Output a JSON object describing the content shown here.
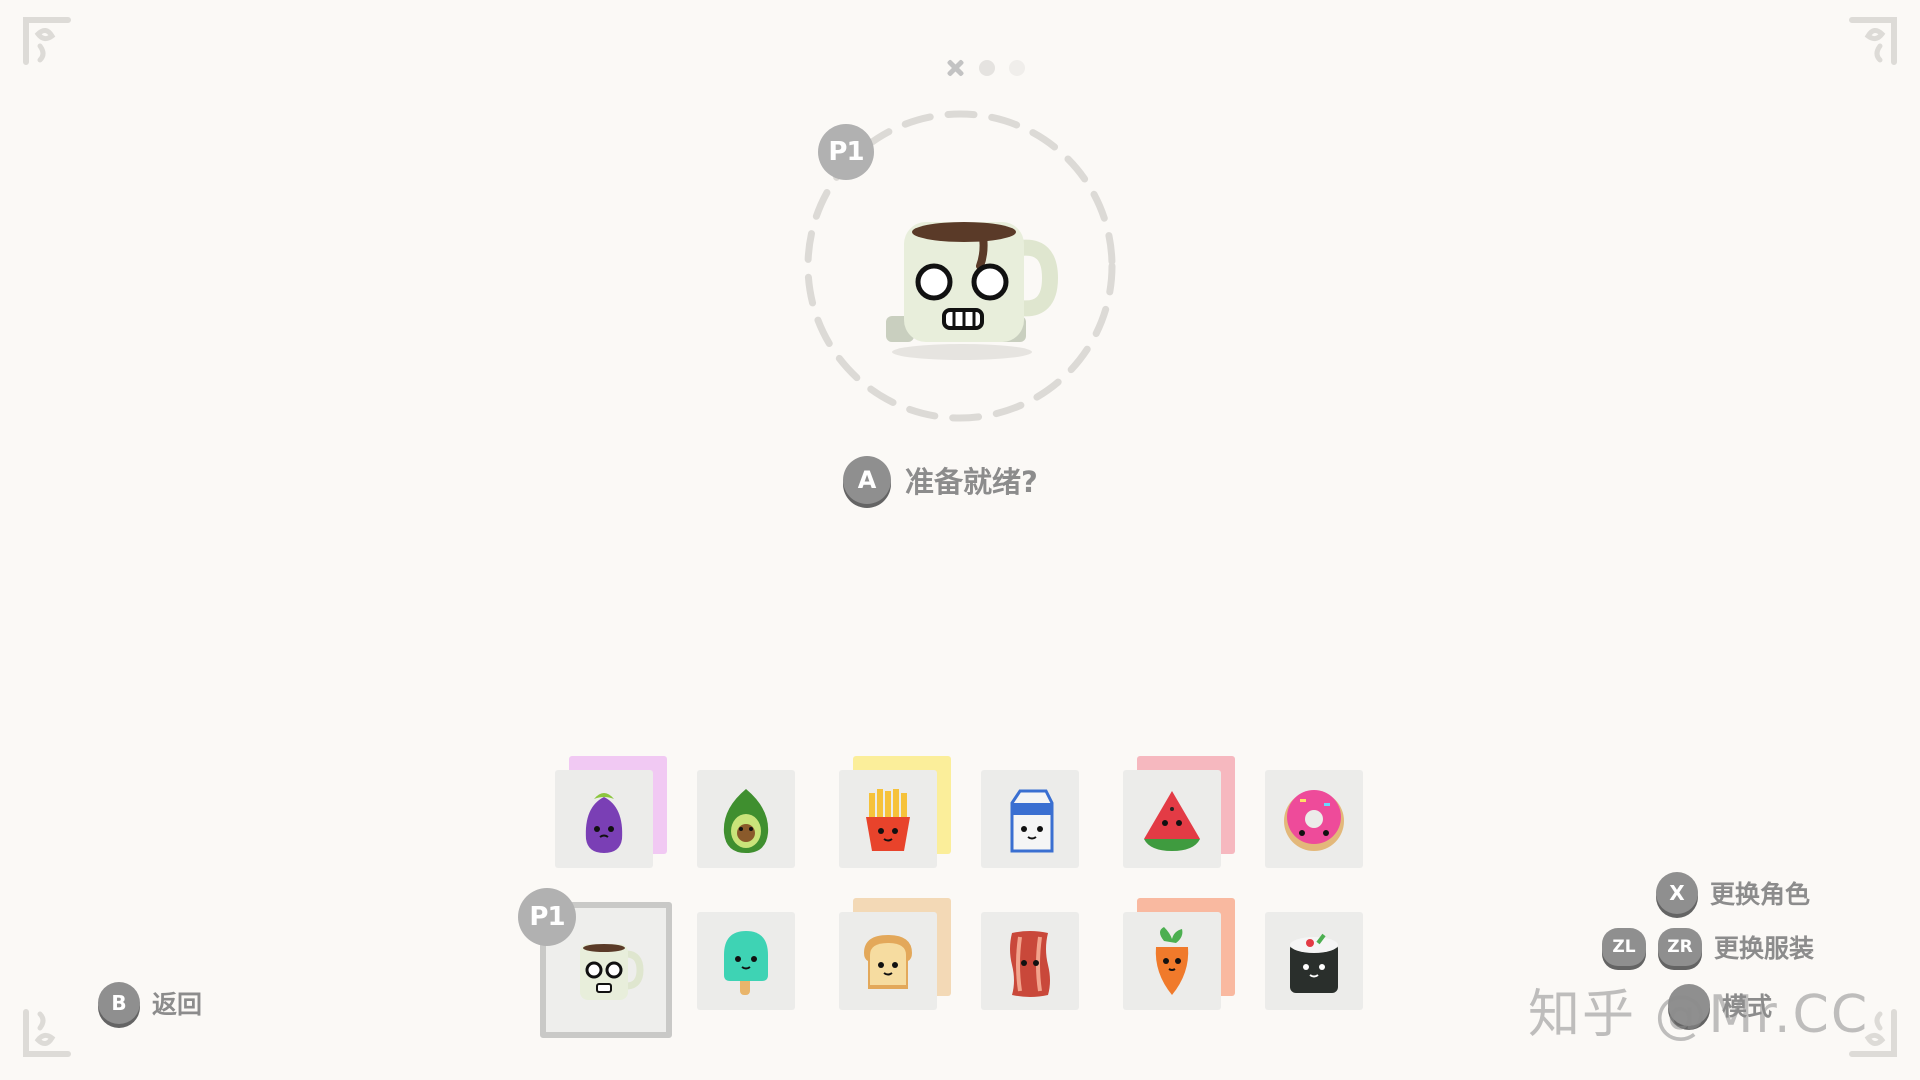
{
  "header": {
    "page_indicator": [
      "close",
      "dot",
      "dot"
    ]
  },
  "player": {
    "badge": "P1",
    "selected_character": "coffee-mug"
  },
  "ready_prompt": {
    "button": "A",
    "text": "准备就绪?"
  },
  "roster": {
    "top_row": [
      "eggplant",
      "avocado",
      "fries",
      "milk-carton",
      "watermelon",
      "donut"
    ],
    "bottom_row": [
      "coffee-mug",
      "popsicle",
      "toast",
      "bacon",
      "carrot",
      "sushi"
    ]
  },
  "controls": {
    "back": {
      "button": "B",
      "label": "返回"
    },
    "change_character": {
      "button": "X",
      "label": "更换角色"
    },
    "change_outfit": {
      "button_left": "ZL",
      "button_right": "ZR",
      "label": "更换服装"
    },
    "mode": {
      "label": "模式"
    }
  },
  "watermark": "知乎 @Mr.CC",
  "colors": {
    "background": "#fbf9f6",
    "badge": "#b1b1b1",
    "button": "#8f8f8f",
    "text": "#8c8c8c"
  }
}
